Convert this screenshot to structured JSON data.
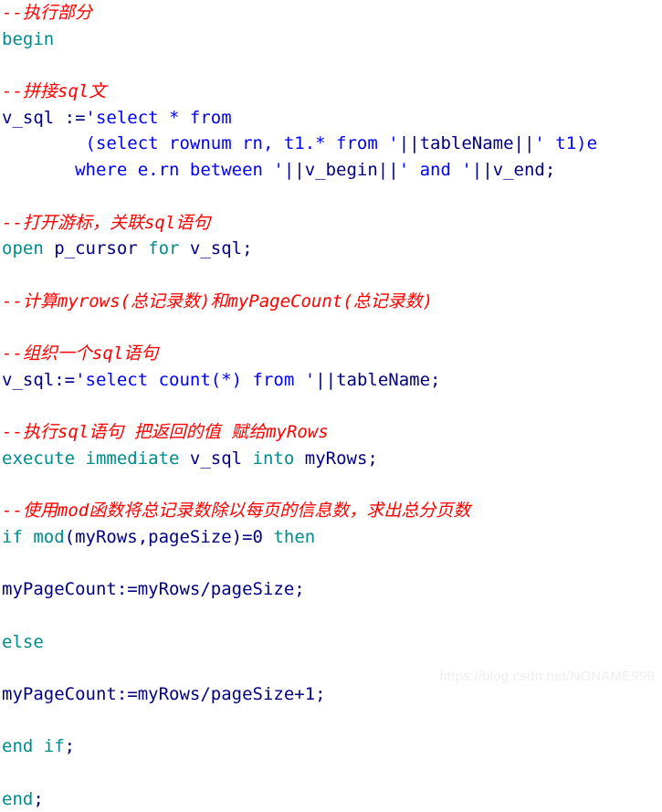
{
  "editor": {
    "language": "PL/SQL",
    "background_color": "#ffffff",
    "colors": {
      "comment": "#FF0000",
      "keyword": "#008B8B",
      "identifier": "#000080",
      "string": "#0000FF"
    },
    "lines": [
      {
        "id": "l1",
        "type": "comment",
        "text": "--执行部分"
      },
      {
        "id": "l2",
        "type": "code",
        "text": "begin"
      },
      {
        "id": "l3",
        "type": "blank",
        "text": ""
      },
      {
        "id": "l4",
        "type": "comment",
        "text": "--拼接sql文"
      },
      {
        "id": "l5",
        "type": "code",
        "text": "v_sql :='select * from"
      },
      {
        "id": "l6",
        "type": "code",
        "text": "        (select rownum rn, t1.* from '||tableName||' t1)e"
      },
      {
        "id": "l7",
        "type": "code",
        "text": "       where e.rn between '||v_begin||' and '||v_end;"
      },
      {
        "id": "l8",
        "type": "blank",
        "text": ""
      },
      {
        "id": "l9",
        "type": "comment",
        "text": "--打开游标，关联sql语句"
      },
      {
        "id": "l10",
        "type": "code",
        "text": "open p_cursor for v_sql;"
      },
      {
        "id": "l11",
        "type": "blank",
        "text": ""
      },
      {
        "id": "l12",
        "type": "comment",
        "text": "--计算myrows(总记录数)和myPageCount(总记录数)"
      },
      {
        "id": "l13",
        "type": "blank",
        "text": ""
      },
      {
        "id": "l14",
        "type": "comment",
        "text": "--组织一个sql语句"
      },
      {
        "id": "l15",
        "type": "code",
        "text": "v_sql:='select count(*) from '||tableName;"
      },
      {
        "id": "l16",
        "type": "blank",
        "text": ""
      },
      {
        "id": "l17",
        "type": "comment",
        "text": "--执行sql语句 把返回的值 赋给myRows"
      },
      {
        "id": "l18",
        "type": "code",
        "text": "execute immediate v_sql into myRows;"
      },
      {
        "id": "l19",
        "type": "blank",
        "text": ""
      },
      {
        "id": "l20",
        "type": "comment",
        "text": "--使用mod函数将总记录数除以每页的信息数，求出总分页数"
      },
      {
        "id": "l21",
        "type": "code",
        "text": "if mod(myRows,pageSize)=0 then"
      },
      {
        "id": "l22",
        "type": "blank",
        "text": ""
      },
      {
        "id": "l23",
        "type": "code",
        "text": "myPageCount:=myRows/pageSize;"
      },
      {
        "id": "l24",
        "type": "blank",
        "text": ""
      },
      {
        "id": "l25",
        "type": "code",
        "text": "else"
      },
      {
        "id": "l26",
        "type": "blank",
        "text": ""
      },
      {
        "id": "l27",
        "type": "code",
        "text": "myPageCount:=myRows/pageSize+1;"
      },
      {
        "id": "l28",
        "type": "blank",
        "text": ""
      },
      {
        "id": "l29",
        "type": "code",
        "text": "end if;"
      },
      {
        "id": "l30",
        "type": "blank",
        "text": ""
      },
      {
        "id": "l31",
        "type": "code",
        "text": "end;"
      }
    ],
    "tokenized_lines": [
      [
        {
          "t": "--执行部分",
          "c": "comment"
        }
      ],
      [
        {
          "t": "begin",
          "c": "keyword"
        }
      ],
      [],
      [
        {
          "t": "--拼接sql文",
          "c": "comment"
        }
      ],
      [
        {
          "t": "v_sql ",
          "c": "identifier"
        },
        {
          "t": ":=",
          "c": "identifier"
        },
        {
          "t": "'select * from",
          "c": "string"
        }
      ],
      [
        {
          "t": "        ",
          "c": "identifier"
        },
        {
          "t": "(select rownum rn, t1.* from '",
          "c": "string"
        },
        {
          "t": "||tableName||",
          "c": "identifier"
        },
        {
          "t": "' t1)e",
          "c": "string"
        }
      ],
      [
        {
          "t": "       ",
          "c": "identifier"
        },
        {
          "t": "where e.rn between '",
          "c": "string"
        },
        {
          "t": "||v_begin||",
          "c": "identifier"
        },
        {
          "t": "' and '",
          "c": "string"
        },
        {
          "t": "||v_end;",
          "c": "identifier"
        }
      ],
      [],
      [
        {
          "t": "--打开游标，关联sql语句",
          "c": "comment"
        }
      ],
      [
        {
          "t": "open ",
          "c": "keyword"
        },
        {
          "t": "p_cursor ",
          "c": "identifier"
        },
        {
          "t": "for ",
          "c": "keyword"
        },
        {
          "t": "v_sql;",
          "c": "identifier"
        }
      ],
      [],
      [
        {
          "t": "--计算myrows(总记录数)和myPageCount(总记录数)",
          "c": "comment"
        }
      ],
      [],
      [
        {
          "t": "--组织一个sql语句",
          "c": "comment"
        }
      ],
      [
        {
          "t": "v_sql:=",
          "c": "identifier"
        },
        {
          "t": "'select count(*) from '",
          "c": "string"
        },
        {
          "t": "||tableName;",
          "c": "identifier"
        }
      ],
      [],
      [
        {
          "t": "--执行sql语句 把返回的值 赋给myRows",
          "c": "comment"
        }
      ],
      [
        {
          "t": "execute immediate ",
          "c": "keyword"
        },
        {
          "t": "v_sql ",
          "c": "identifier"
        },
        {
          "t": "into ",
          "c": "keyword"
        },
        {
          "t": "myRows;",
          "c": "identifier"
        }
      ],
      [],
      [
        {
          "t": "--使用mod函数将总记录数除以每页的信息数，求出总分页数",
          "c": "comment"
        }
      ],
      [
        {
          "t": "if ",
          "c": "keyword"
        },
        {
          "t": "mod",
          "c": "keyword"
        },
        {
          "t": "(myRows,pageSize)=0 ",
          "c": "identifier"
        },
        {
          "t": "then",
          "c": "keyword"
        }
      ],
      [],
      [
        {
          "t": "myPageCount:=myRows/pageSize;",
          "c": "identifier"
        }
      ],
      [],
      [
        {
          "t": "else",
          "c": "keyword"
        }
      ],
      [],
      [
        {
          "t": "myPageCount:=myRows/pageSize+1;",
          "c": "identifier"
        }
      ],
      [],
      [
        {
          "t": "end if",
          "c": "keyword"
        },
        {
          "t": ";",
          "c": "identifier"
        }
      ],
      [],
      [
        {
          "t": "end",
          "c": "keyword"
        },
        {
          "t": ";",
          "c": "identifier"
        }
      ]
    ]
  },
  "watermark": {
    "text": "https://blog.csdn.net/NONAME999",
    "color": "#eeeeee"
  }
}
